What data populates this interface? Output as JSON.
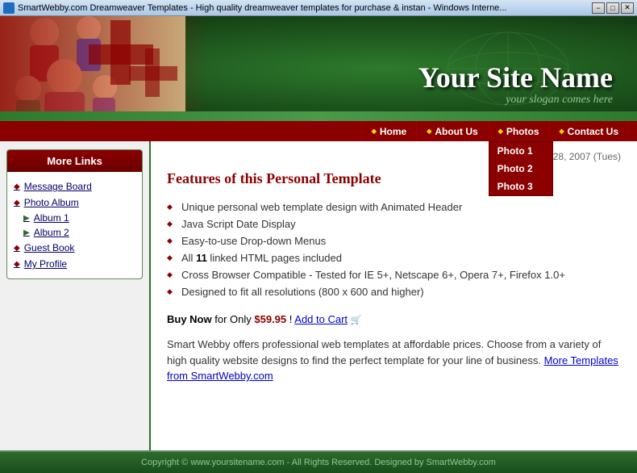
{
  "titlebar": {
    "text": "SmartWebby.com Dreamweaver Templates - High quality dreamweaver templates for purchase & instan - Windows Interne...",
    "minimize": "−",
    "maximize": "□",
    "close": "✕"
  },
  "header": {
    "site_title": "Your Site Name",
    "slogan": "your slogan comes here"
  },
  "nav": {
    "items": [
      {
        "label": "Home",
        "id": "home"
      },
      {
        "label": "About Us",
        "id": "about"
      },
      {
        "label": "Photos",
        "id": "photos",
        "has_dropdown": true
      },
      {
        "label": "Contact Us",
        "id": "contact"
      }
    ],
    "photos_dropdown": [
      {
        "label": "Photo 1"
      },
      {
        "label": "Photo 2"
      },
      {
        "label": "Photo 3"
      }
    ]
  },
  "sidebar": {
    "header": "More Links",
    "links": [
      {
        "type": "diamond",
        "label": "Message Board"
      },
      {
        "type": "diamond",
        "label": "Photo Album"
      },
      {
        "type": "arrow",
        "label": "Album 1"
      },
      {
        "type": "arrow",
        "label": "Album 2"
      },
      {
        "type": "diamond",
        "label": "Guest Book"
      },
      {
        "type": "diamond",
        "label": "My Profile"
      }
    ]
  },
  "content": {
    "date": "Aug 28, 2007 (Tues)",
    "title": "Features of this Personal Template",
    "features": [
      "Unique personal web template design with Animated Header",
      "Java Script Date Display",
      "Easy-to-use Drop-down Menus",
      "All 11 linked HTML pages included",
      "Cross Browser Compatible - Tested for IE 5+, Netscape 6+, Opera 7+, Firefox 1.0+",
      "Designed to fit all resolutions (800 x 600 and higher)"
    ],
    "feature_bold_word": "11",
    "buy_label": "Buy Now",
    "buy_price": "$59.95",
    "buy_separator": "! ",
    "add_to_cart": "Add to Cart",
    "description": "Smart Webby offers professional web templates at affordable prices. Choose from a variety of high quality website designs to find the perfect template for your line of business.",
    "more_link": "More Templates from SmartWebby.com"
  },
  "footer": {
    "text": "Copyright © www.yoursitename.com - All Rights Reserved. Designed by SmartWebby.com"
  }
}
